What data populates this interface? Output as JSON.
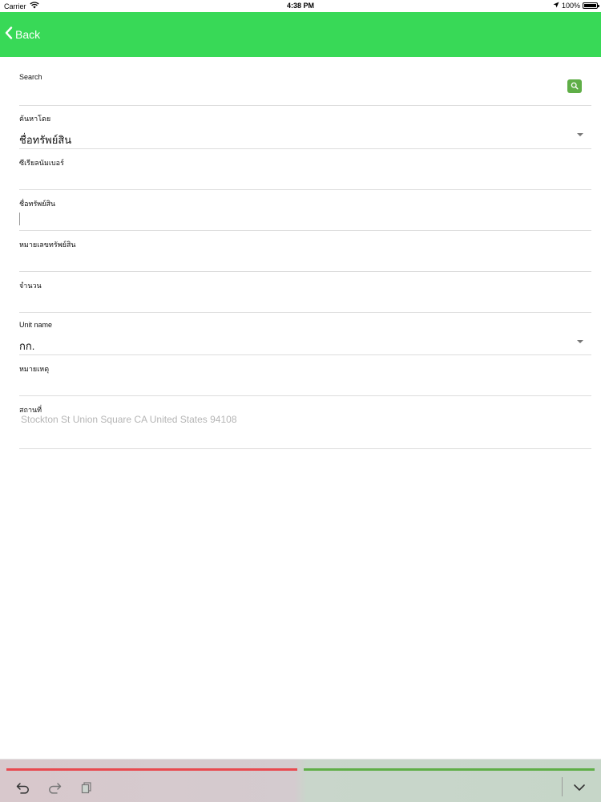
{
  "status_bar": {
    "carrier": "Carrier",
    "time": "4:38 PM",
    "battery": "100%",
    "battery_level": 1.0
  },
  "nav": {
    "back_label": "Back"
  },
  "form": {
    "search": {
      "label": "Search",
      "value": ""
    },
    "search_by": {
      "label": "ค้นหาโดย",
      "value": "ชื่อทรัพย์สิน"
    },
    "serial_number": {
      "label": "ซีเรียลนัมเบอร์",
      "value": ""
    },
    "asset_name": {
      "label": "ชื่อทรัพย์สิน",
      "value": ""
    },
    "asset_number": {
      "label": "หมายเลขทรัพย์สิน",
      "value": ""
    },
    "quantity": {
      "label": "จำนวน",
      "value": ""
    },
    "unit_name": {
      "label": "Unit name",
      "value": "กก."
    },
    "note": {
      "label": "หมายเหตุ",
      "value": ""
    },
    "location": {
      "label": "สถานที่",
      "value": "Stockton St Union Square CA United States 94108"
    }
  },
  "icons": {
    "search_button": "search-icon",
    "undo": "undo-icon",
    "redo": "redo-icon",
    "paste": "paste-icon",
    "dismiss_keyboard": "chevron-down-icon"
  },
  "colors": {
    "nav_bar": "#38d957",
    "search_button": "#5fae47",
    "bottom_left_bar": "#e8494f",
    "bottom_right_bar": "#5fae47"
  }
}
